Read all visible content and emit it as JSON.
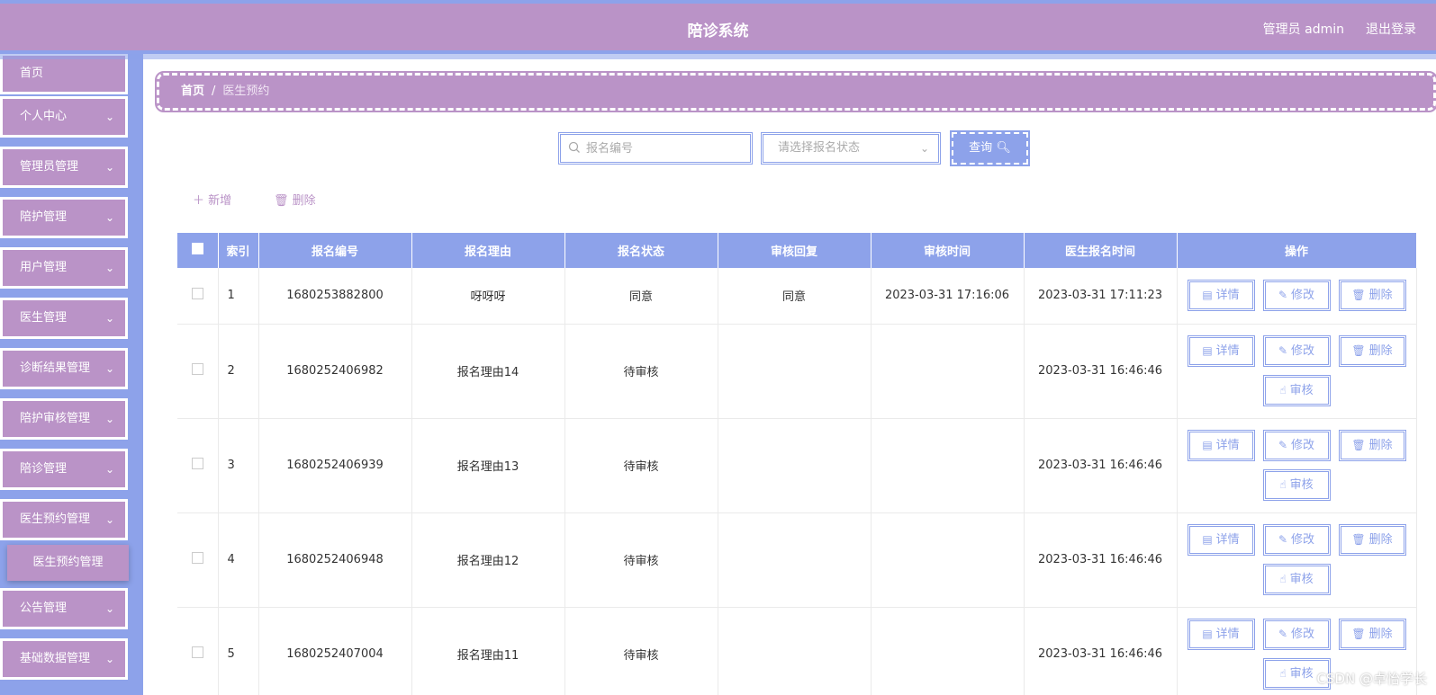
{
  "header": {
    "title": "陪诊系统",
    "user": "管理员 admin",
    "logout": "退出登录"
  },
  "sidebar": {
    "items": [
      {
        "label": "首页",
        "has_chevron": false
      },
      {
        "label": "个人中心",
        "has_chevron": true
      },
      {
        "label": "管理员管理",
        "has_chevron": true
      },
      {
        "label": "陪护管理",
        "has_chevron": true
      },
      {
        "label": "用户管理",
        "has_chevron": true
      },
      {
        "label": "医生管理",
        "has_chevron": true
      },
      {
        "label": "诊断结果管理",
        "has_chevron": true
      },
      {
        "label": "陪护审核管理",
        "has_chevron": true
      },
      {
        "label": "陪诊管理",
        "has_chevron": true
      },
      {
        "label": "医生预约管理",
        "has_chevron": true
      },
      {
        "label": "公告管理",
        "has_chevron": true
      },
      {
        "label": "基础数据管理",
        "has_chevron": true
      }
    ],
    "sub_item": "医生预约管理"
  },
  "breadcrumb": {
    "home": "首页",
    "separator": "/",
    "current": "医生预约"
  },
  "search": {
    "placeholder": "报名编号",
    "status_placeholder": "请选择报名状态",
    "query_label": "查询"
  },
  "actions": {
    "add": "新增",
    "delete": "删除"
  },
  "table": {
    "columns": [
      "索引",
      "报名编号",
      "报名理由",
      "报名状态",
      "审核回复",
      "审核时间",
      "医生报名时间",
      "操作"
    ],
    "rows": [
      {
        "index": "1",
        "number": "1680253882800",
        "reason": "呀呀呀",
        "status": "同意",
        "reply": "同意",
        "review_time": "2023-03-31 17:16:06",
        "apply_time": "2023-03-31 17:11:23",
        "can_review": false
      },
      {
        "index": "2",
        "number": "1680252406982",
        "reason": "报名理由14",
        "status": "待审核",
        "reply": "",
        "review_time": "",
        "apply_time": "2023-03-31 16:46:46",
        "can_review": true
      },
      {
        "index": "3",
        "number": "1680252406939",
        "reason": "报名理由13",
        "status": "待审核",
        "reply": "",
        "review_time": "",
        "apply_time": "2023-03-31 16:46:46",
        "can_review": true
      },
      {
        "index": "4",
        "number": "1680252406948",
        "reason": "报名理由12",
        "status": "待审核",
        "reply": "",
        "review_time": "",
        "apply_time": "2023-03-31 16:46:46",
        "can_review": true
      },
      {
        "index": "5",
        "number": "1680252407004",
        "reason": "报名理由11",
        "status": "待审核",
        "reply": "",
        "review_time": "",
        "apply_time": "2023-03-31 16:46:46",
        "can_review": true
      }
    ],
    "op_labels": {
      "detail": "详情",
      "edit": "修改",
      "delete": "删除",
      "review": "审核"
    }
  },
  "watermark": "CSDN @卓怡学长",
  "colors": {
    "primary": "#8da2ea",
    "accent": "#ba93c7"
  }
}
